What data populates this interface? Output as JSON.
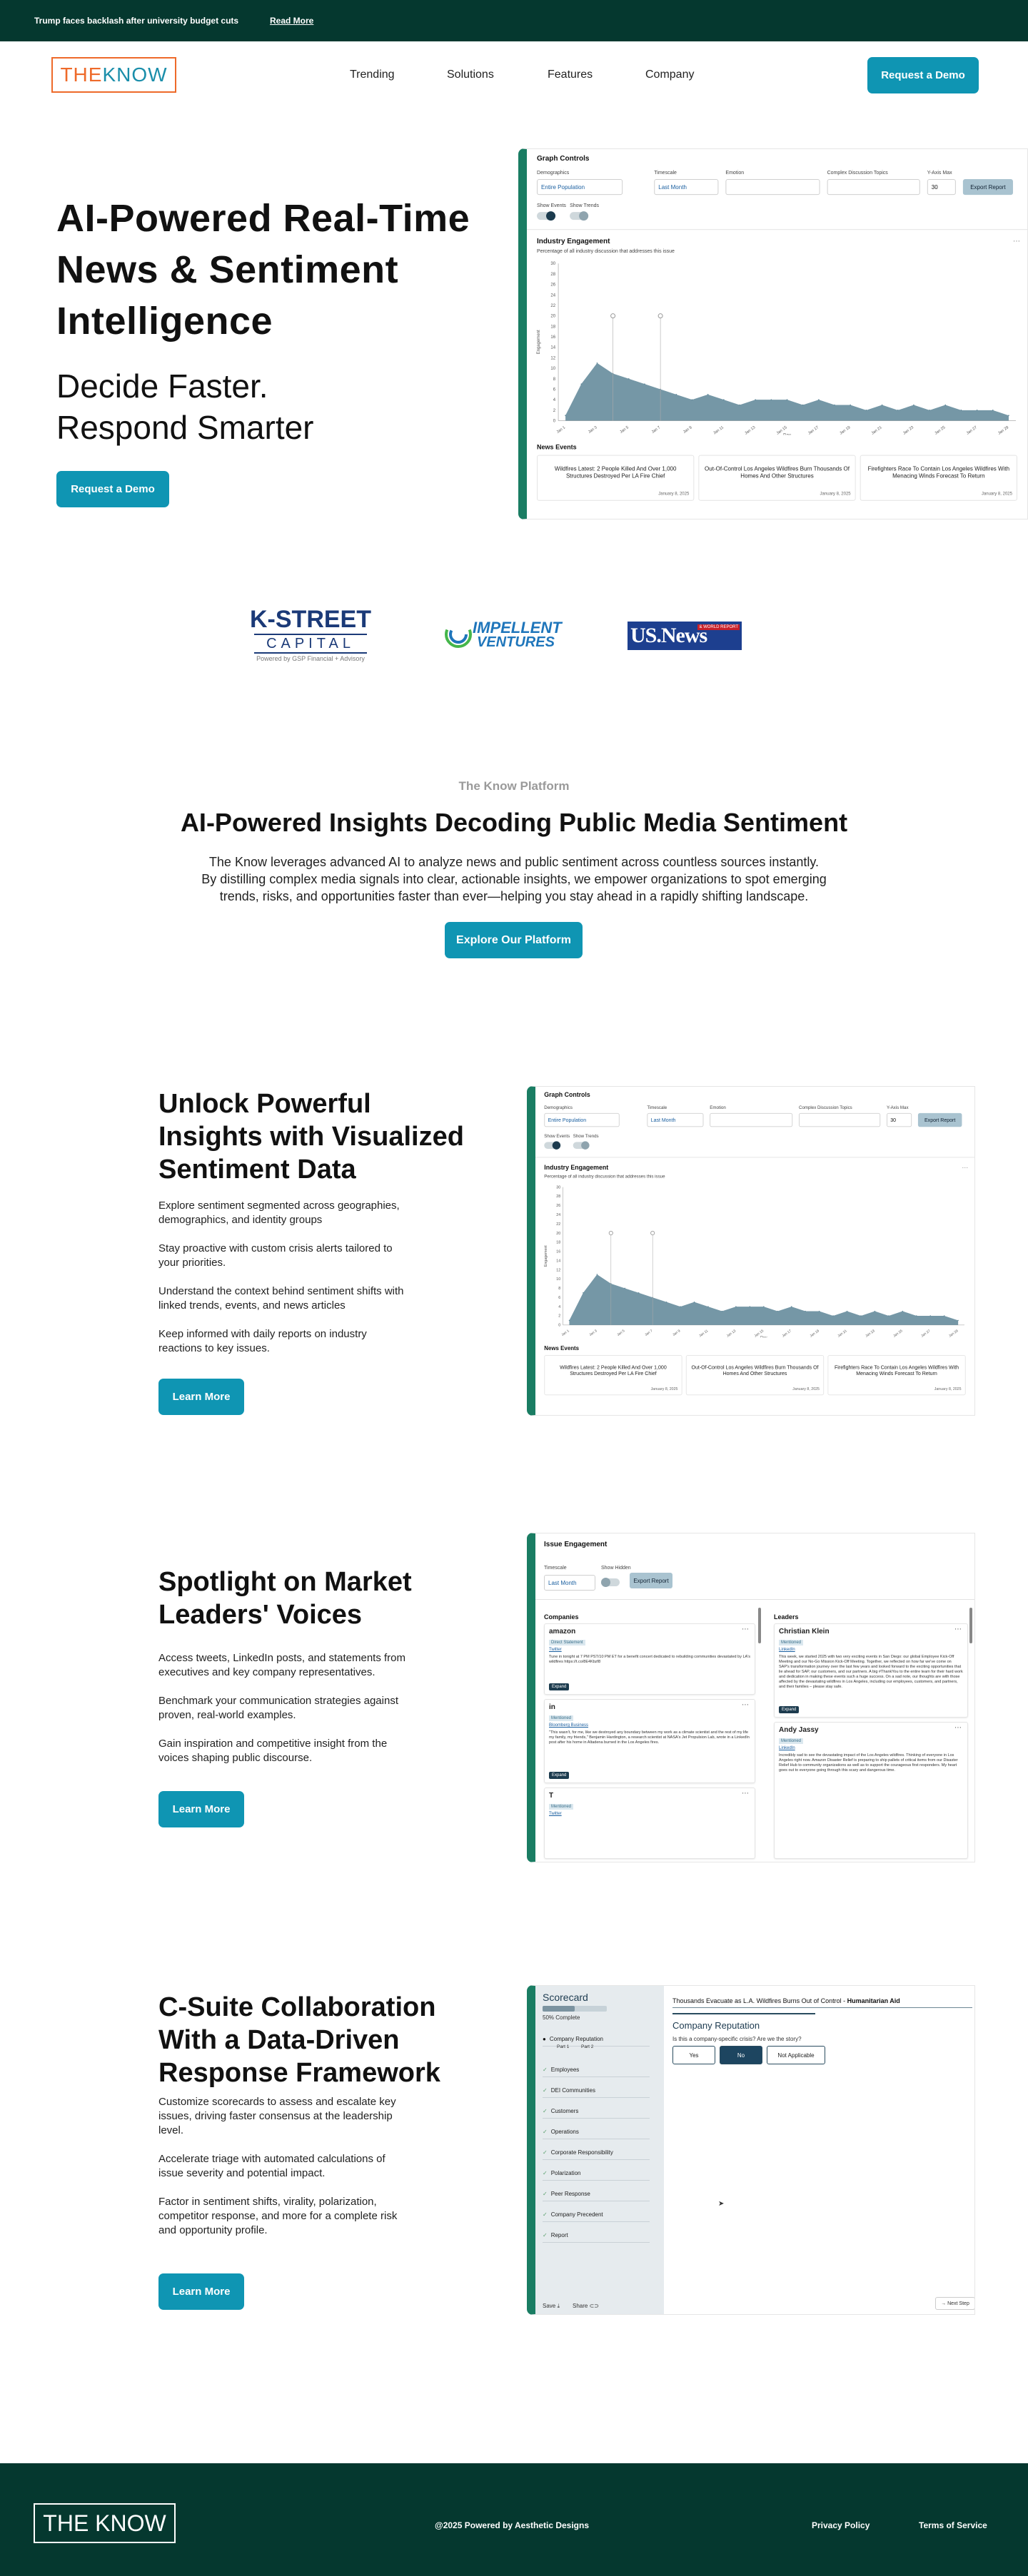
{
  "banner": {
    "text": "Trump faces backlash after university budget cuts",
    "link": "Read More"
  },
  "nav": {
    "logo": {
      "the": "THE ",
      "know": "KNOW"
    },
    "links": [
      "Trending",
      "Solutions",
      "Features",
      "Company"
    ],
    "cta": "Request a Demo"
  },
  "hero": {
    "title_lines": [
      "AI-Powered Real-Time",
      "News & Sentiment",
      "Intelligence"
    ],
    "subtitle_lines": [
      "Decide Faster.",
      "Respond Smarter"
    ],
    "cta": "Request a Demo"
  },
  "dashboard": {
    "graph_controls": "Graph Controls",
    "demographics_label": "Demographics",
    "demographics_value": "Entire Population",
    "timescale_label": "Timescale",
    "timescale_value": "Last Month",
    "emotion_label": "Emotion",
    "topics_label": "Complex Discussion Topics",
    "yaxis_label": "Y-Axis Max",
    "yaxis_value": "30",
    "export": "Export Report",
    "show_events": "Show Events",
    "show_trends": "Show Trends",
    "industry_title": "Industry Engagement",
    "chart_subtitle": "Percentage of all industry discussion that addresses this issue",
    "chart_ylabel": "Engagement",
    "chart_xlabel": "Day",
    "news_events": "News Events",
    "news": [
      {
        "title": "Wildfires Latest: 2 People Killed And Over 1,000 Structures Destroyed Per LA Fire Chief",
        "date": "January 8, 2025"
      },
      {
        "title": "Out-Of-Control Los Angeles Wildfires Burn Thousands Of Homes And Other Structures",
        "date": "January 8, 2025"
      },
      {
        "title": "Firefighters Race To Contain Los Angeles Wildfires With Menacing Winds Forecast To Return",
        "date": "January 8, 2025"
      }
    ]
  },
  "chart_data": {
    "type": "area",
    "x": [
      "Jan 1",
      "Jan 3",
      "Jan 5",
      "Jan 7",
      "Jan 9",
      "Jan 11",
      "Jan 13",
      "Jan 15",
      "Jan 17",
      "Jan 19",
      "Jan 21",
      "Jan 23",
      "Jan 25",
      "Jan 27",
      "Jan 29"
    ],
    "series": [
      {
        "values": [
          1,
          7,
          11,
          9,
          8,
          7,
          6,
          5,
          4,
          5,
          4,
          3,
          4,
          4,
          4,
          3,
          4,
          3,
          3,
          2,
          3,
          2,
          3,
          2,
          3,
          2,
          2,
          2,
          1
        ]
      }
    ],
    "ylim": [
      0,
      30
    ],
    "yticks": [
      0,
      2,
      4,
      6,
      8,
      10,
      12,
      14,
      16,
      18,
      20,
      22,
      24,
      26,
      28,
      30
    ],
    "color": "#5d8596"
  },
  "partners": {
    "kstreet": {
      "line1": "K-STREET",
      "line2": "CAPITAL",
      "line3": "Powered by GSP Financial + Advisory"
    },
    "impellent": {
      "line1": "IMPELLENT",
      "line2": "VENTURES"
    },
    "usnews": {
      "text": "US.News",
      "tag": "& WORLD REPORT"
    }
  },
  "platform": {
    "eyebrow": "The Know Platform",
    "title": "AI-Powered Insights Decoding Public Media Sentiment",
    "body_lines": [
      "The Know leverages advanced AI to analyze news and public sentiment across countless sources instantly.",
      "By distilling complex media signals into clear, actionable insights, we empower organizations to spot emerging",
      "trends, risks, and opportunities faster than ever—helping you stay ahead in a rapidly shifting landscape."
    ],
    "cta": "Explore Our Platform"
  },
  "feature1": {
    "title_lines": [
      "Unlock Powerful",
      "Insights with Visualized",
      "Sentiment Data"
    ],
    "points": [
      [
        "Explore sentiment segmented across geographies,",
        "demographics, and identity groups"
      ],
      [
        "Stay proactive with custom crisis alerts tailored to",
        "your priorities."
      ],
      [
        "Understand the context behind sentiment shifts with",
        "linked trends, events, and news articles"
      ],
      [
        "Keep informed with daily reports on industry",
        "reactions to key issues."
      ]
    ],
    "cta": "Learn More"
  },
  "feature2": {
    "title_lines": [
      "Spotlight on Market",
      "Leaders' Voices"
    ],
    "points": [
      [
        "Access tweets, LinkedIn posts, and statements from",
        "executives and key company representatives."
      ],
      [
        "Benchmark your communication strategies against",
        "proven, real-world examples."
      ],
      [
        "Gain inspiration and competitive insight from the",
        "voices shaping public discourse."
      ]
    ],
    "cta": "Learn More",
    "mock": {
      "title": "Issue Engagement",
      "timescale_label": "Timescale",
      "timescale_value": "Last Month",
      "show_hidden": "Show Hidden",
      "export": "Export Report",
      "companies": "Companies",
      "leaders": "Leaders",
      "company_posts": [
        {
          "name": "amazon",
          "tag": "Direct Statement",
          "source": "Twitter",
          "text": "Tune in tonight at 7 PM PST/10 PM ET for a benefit concert dedicated to rebuilding communities devastated by LA's wildfires https://t.co/8E4Kbzf8",
          "btn": "Expand"
        },
        {
          "name": "in",
          "tag": "Mentioned",
          "source": "Bloomberg Business",
          "text": "\"This wasn't, for me, like we destroyed any boundary between my work as a climate scientist and the rest of my life my family, my friends,\" Benjamin Hardington, a research scientist at NASA's Jet Propulsion Lab, wrote in a LinkedIn post after his home in Altadena burned in the Los Angeles fires.",
          "btn": "Expand"
        },
        {
          "name": "T",
          "tag": "Mentioned",
          "source": "Twitter",
          "text": "",
          "btn": ""
        }
      ],
      "leader_posts": [
        {
          "name": "Christian Klein",
          "tag": "Mentioned",
          "source": "LinkedIn",
          "text": "This week, we started 2025 with two very exciting events in San Diego: our global Employee Kick-Off Meeting and our No-Go Mission Kick-Off Meeting. Together, we reflected on how far we've come on SAP's transformation journey over the last few years and looked forward to the exciting opportunities that lie ahead for SAP, our customers, and our partners. A big #ThankYou to the entire team for their hard work and dedication in making these events such a huge success. On a sad note, our thoughts are with those affected by the devastating wildfires in Los Angeles, including our employees, customers, and partners, and their families – please stay safe.",
          "btn": "Expand"
        },
        {
          "name": "Andy Jassy",
          "tag": "Mentioned",
          "source": "LinkedIn",
          "text": "Incredibly sad to see the devastating impact of the Los Angeles wildfires. Thinking of everyone in Los Angeles right now. Amazon Disaster Relief is preparing to ship pallets of critical items from our Disaster Relief Hub to community organizations as well as to support the courageous first responders. My heart goes out to everyone going through this scary and dangerous time.",
          "btn": ""
        }
      ]
    }
  },
  "feature3": {
    "title_lines": [
      "C-Suite Collaboration",
      "With a Data-Driven",
      "Response Framework"
    ],
    "points": [
      [
        "Customize scorecards to assess and escalate key",
        "issues, driving faster consensus at the leadership",
        "level."
      ],
      [
        "Accelerate triage with automated calculations of",
        "issue severity and potential impact."
      ],
      [
        "Factor in sentiment shifts, virality, polarization,",
        "competitor response, and more for a complete risk",
        "and opportunity profile."
      ]
    ],
    "cta": "Learn More",
    "mock": {
      "title": "Scorecard",
      "progress": 0.5,
      "progress_text": "50% Complete",
      "header": "Thousands Evacuate as L.A. Wildfires Burns Out of Control -",
      "header_tag": "Humanitarian Aid",
      "section": "Company Reputation",
      "question": "Is this a company-specific crisis? Are we the story?",
      "options": [
        "Yes",
        "No",
        "Not Applicable"
      ],
      "selected": "No",
      "nav_items": [
        "Company Reputation",
        "Employees",
        "DEI Communities",
        "Customers",
        "Operations",
        "Corporate Responsibility",
        "Polarization",
        "Peer Response",
        "Company Precedent",
        "Report"
      ],
      "parts": [
        "Part 1",
        "Part 2"
      ],
      "save": "Save",
      "share": "Share",
      "next": "Next Step"
    }
  },
  "footer": {
    "logo": "THE KNOW",
    "copyright": "@2025 Powered by Aesthetic Designs",
    "privacy": "Privacy Policy",
    "terms": "Terms of Service"
  }
}
